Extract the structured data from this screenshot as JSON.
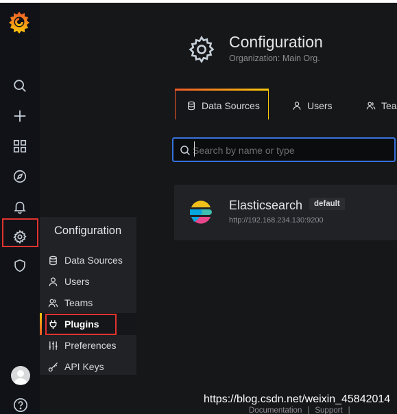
{
  "sidebar": {
    "items": [
      {
        "name": "search",
        "icon": "search-icon"
      },
      {
        "name": "create",
        "icon": "plus-icon"
      },
      {
        "name": "dashboards",
        "icon": "grid-icon"
      },
      {
        "name": "explore",
        "icon": "compass-icon"
      },
      {
        "name": "alerting",
        "icon": "bell-icon"
      },
      {
        "name": "configuration",
        "icon": "gear-icon"
      },
      {
        "name": "server-admin",
        "icon": "shield-icon"
      }
    ]
  },
  "header": {
    "title": "Configuration",
    "subtitle": "Organization: Main Org."
  },
  "tabs": [
    {
      "label": "Data Sources",
      "icon": "database-icon",
      "active": true
    },
    {
      "label": "Users",
      "icon": "user-icon",
      "active": false
    },
    {
      "label": "Teams",
      "icon": "users-icon",
      "active": false
    }
  ],
  "search": {
    "placeholder": "Search by name or type",
    "value": ""
  },
  "datasource": {
    "name": "Elasticsearch",
    "badge": "default",
    "url": "http://192.168.234.130:9200",
    "icon": "elasticsearch-logo"
  },
  "menu": {
    "title": "Configuration",
    "items": [
      {
        "label": "Data Sources",
        "icon": "database-icon"
      },
      {
        "label": "Users",
        "icon": "user-icon"
      },
      {
        "label": "Teams",
        "icon": "users-icon"
      },
      {
        "label": "Plugins",
        "icon": "plug-icon",
        "active": true
      },
      {
        "label": "Preferences",
        "icon": "sliders-icon"
      },
      {
        "label": "API Keys",
        "icon": "key-icon"
      }
    ]
  },
  "footer": {
    "documentation": "Documentation",
    "support": "Support",
    "separator": "|"
  },
  "watermark": "https://blog.csdn.net/weixin_45842014",
  "colors": {
    "accent_orange": "#f05a28",
    "accent_yellow": "#fbca0a",
    "highlight_red": "#e0332f",
    "focus_blue": "#3871dc"
  }
}
